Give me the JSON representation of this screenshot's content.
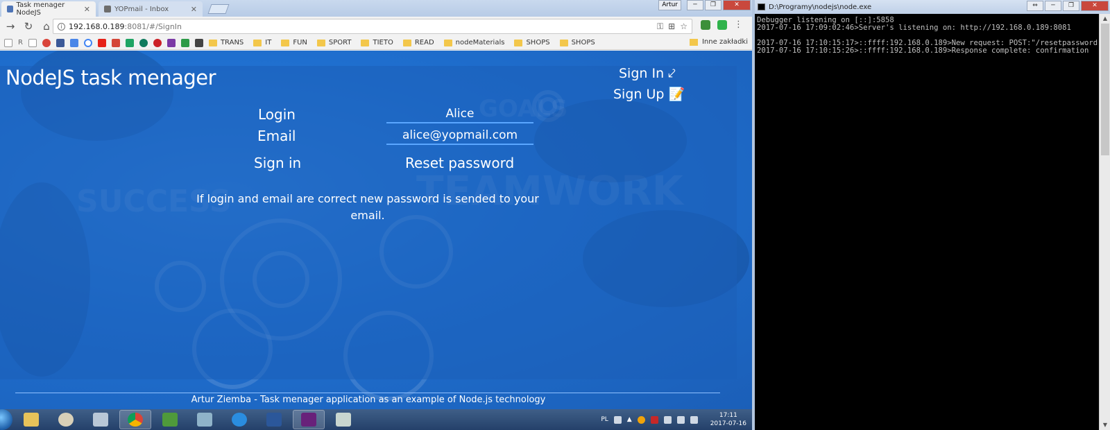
{
  "browser": {
    "tabs": [
      {
        "label": "Task menager NodeJS",
        "active": true
      },
      {
        "label": "YOPmail - Inbox",
        "active": false
      }
    ],
    "user_badge": "Artur",
    "url_host": "192.168.0.189",
    "url_rest": ":8081/#/SignIn",
    "bookmarks": {
      "letter_r": "R",
      "folders": [
        "TRANS",
        "IT",
        "FUN",
        "SPORT",
        "TIETO",
        "READ",
        "nodeMaterials",
        "SHOPS",
        "SHOPS"
      ],
      "other": "Inne zakładki"
    }
  },
  "app": {
    "title": "NodeJS task menager",
    "nav": {
      "sign_in": "Sign In ⤦",
      "sign_up": "Sign Up 📝"
    },
    "form": {
      "login_label": "Login",
      "login_value": "Alice",
      "email_label": "Email",
      "email_value": "alice@yopmail.com",
      "sign_in_button": "Sign in",
      "reset_button": "Reset password"
    },
    "info_message": "If login and email are correct new password is sended to your email.",
    "footer": "Artur Ziemba - Task menager application as an example of Node.js technology",
    "background_words": [
      "SUCCESS",
      "TEAMWORK",
      "GOALS"
    ]
  },
  "console": {
    "title": "D:\\Programy\\nodejs\\node.exe",
    "lines": [
      "Debugger listening on [::]:5858",
      "2017-07-16 17:09:02:46>Server's listening on: http://192.168.0.189:8081",
      "",
      "2017-07-16 17:10:15:17>::ffff:192.168.0.189>New request: POST:\"/resetpassword",
      "2017-07-16 17:10:15:26>::ffff:192.168.0.189>Response complete: confirmation"
    ]
  },
  "taskbar": {
    "language": "PL",
    "time": "17:11",
    "date": "2017-07-16"
  },
  "colors": {
    "page_blue": "#1f6fcf",
    "field_underline": "#5aa6ff",
    "console_bg": "#000000"
  }
}
